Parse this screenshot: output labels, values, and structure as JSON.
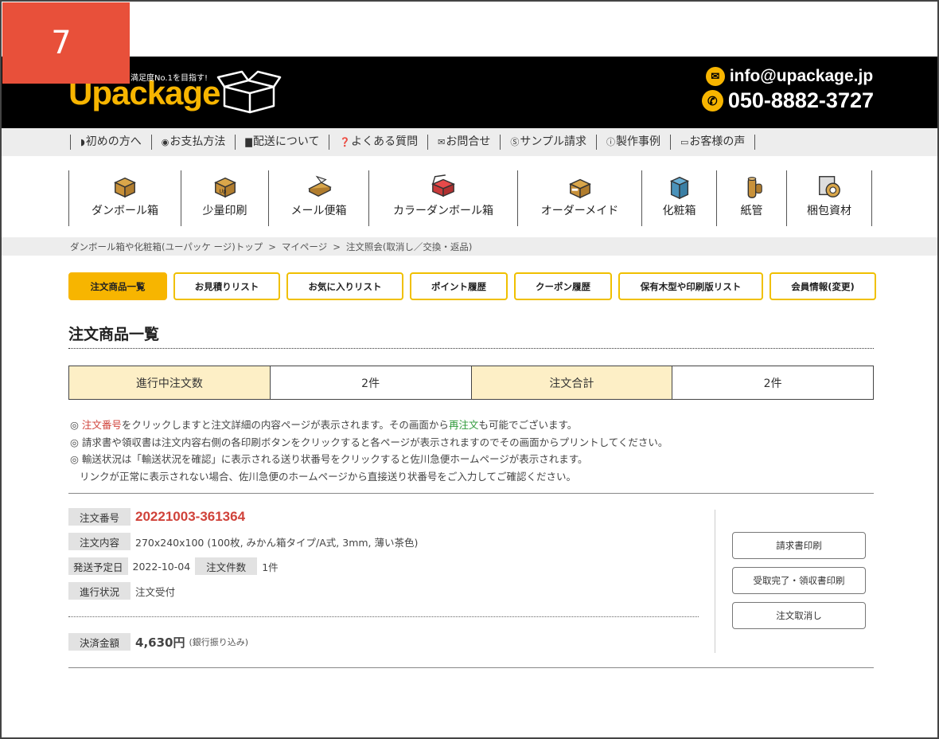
{
  "step_badge": "7",
  "header": {
    "tagline": "満足度No.1を目指す!",
    "logo_text": "Upackage",
    "email": "info@upackage.jp",
    "phone": "050-8882-3727",
    "brand_color": "#f7b500"
  },
  "subnav": [
    {
      "icon": "shield-icon",
      "glyph": "◗",
      "label": "初めの方へ"
    },
    {
      "icon": "yen-icon",
      "glyph": "◉",
      "label": "お支払方法"
    },
    {
      "icon": "truck-icon",
      "glyph": "▇",
      "label": "配送について"
    },
    {
      "icon": "question-icon",
      "glyph": "❓",
      "label": "よくある質問"
    },
    {
      "icon": "mail-icon",
      "glyph": "✉",
      "label": "お問合せ"
    },
    {
      "icon": "sample-icon",
      "glyph": "Ⓢ",
      "label": "サンプル請求"
    },
    {
      "icon": "info-icon",
      "glyph": "ⓘ",
      "label": "製作事例"
    },
    {
      "icon": "chat-icon",
      "glyph": "▭",
      "label": "お客様の声"
    }
  ],
  "categories": [
    {
      "icon": "cardboard-box-icon",
      "label": "ダンボール箱"
    },
    {
      "icon": "printed-box-icon",
      "label": "少量印刷"
    },
    {
      "icon": "mail-box-icon",
      "label": "メール便箱"
    },
    {
      "icon": "color-box-icon",
      "label": "カラーダンボール箱"
    },
    {
      "icon": "order-made-box-icon",
      "label": "オーダーメイド"
    },
    {
      "icon": "cosmetic-box-icon",
      "label": "化粧箱"
    },
    {
      "icon": "paper-tube-icon",
      "label": "紙管"
    },
    {
      "icon": "packing-tape-icon",
      "label": "梱包資材"
    }
  ],
  "breadcrumb": {
    "items": [
      "ダンボール箱や化粧箱(ユーパッケ ージ)トップ",
      "マイページ",
      "注文照会(取消し／交換・返品)"
    ],
    "separator": ">"
  },
  "tabs": [
    {
      "label": "注文商品一覧",
      "active": true
    },
    {
      "label": "お見積りリスト",
      "active": false
    },
    {
      "label": "お気に入りリスト",
      "active": false
    },
    {
      "label": "ポイント履歴",
      "active": false
    },
    {
      "label": "クーポン履歴",
      "active": false
    },
    {
      "label": "保有木型や印刷版リスト",
      "active": false
    },
    {
      "label": "会員情報(変更)",
      "active": false
    }
  ],
  "page_title": "注文商品一覧",
  "summary": {
    "in_progress_label": "進行中注文数",
    "in_progress_value": "2件",
    "total_label": "注文合計",
    "total_value": "2件"
  },
  "notes": {
    "bullet": "◎",
    "line1_red": "注文番号",
    "line1_a": "をクリックしますと注文詳細の内容ページが表示されます。その画面から",
    "line1_green": "再注文",
    "line1_b": "も可能でございます。",
    "line2": "請求書や領収書は注文内容右側の各印刷ボタンをクリックすると各ページが表示されますのでその画面からプリントしてください。",
    "line3": "輸送状況は「輸送状況を確認」に表示される送り状番号をクリックすると佐川急便ホームページが表示されます。",
    "line4": "リンクが正常に表示されない場合、佐川急便のホームページから直接送り状番号をご入力してご確認ください。"
  },
  "order": {
    "number_label": "注文番号",
    "number": "20221003-361364",
    "content_label": "注文内容",
    "content": "270x240x100 (100枚, みかん箱タイプ/A式, 3mm, 薄い茶色)",
    "ship_label": "発送予定日",
    "ship_date": "2022-10-04",
    "count_label": "注文件数",
    "count": "1件",
    "status_label": "進行状況",
    "status": "注文受付",
    "payment_label": "決済金額",
    "amount": "4,630円",
    "method": "(銀行振り込み)"
  },
  "actions": {
    "invoice": "請求書印刷",
    "receipt": "受取完了・領収書印刷",
    "cancel": "注文取消し"
  }
}
